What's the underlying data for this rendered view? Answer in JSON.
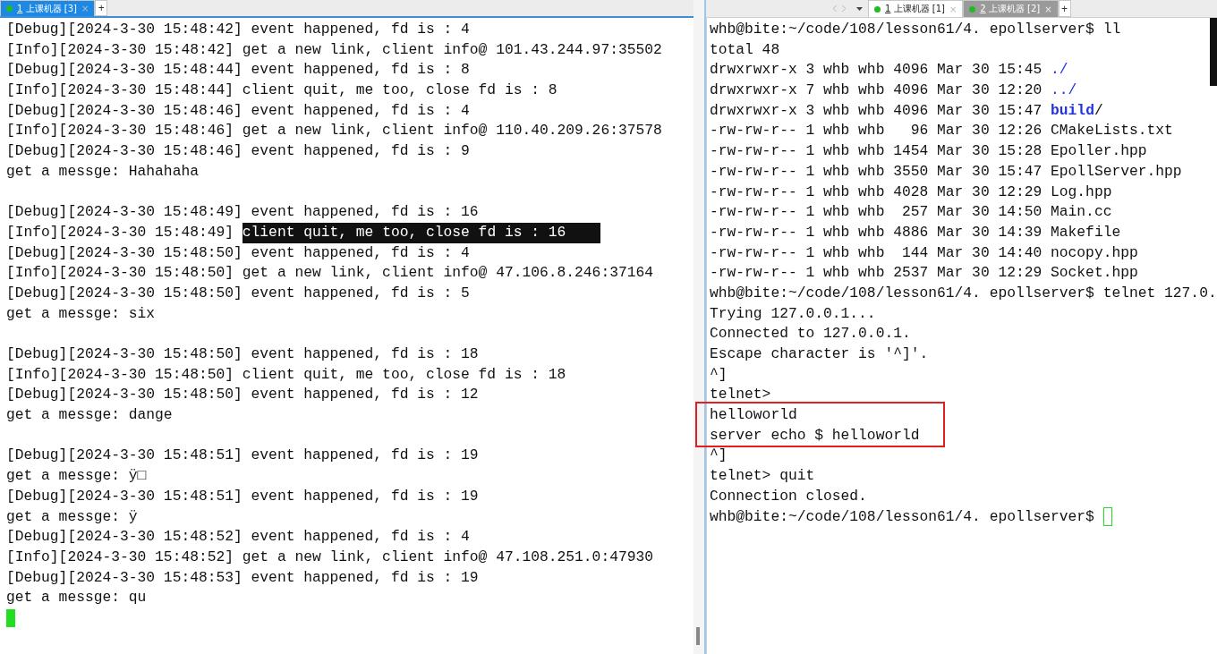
{
  "left_pane": {
    "tabs": [
      {
        "number": "1",
        "label": "上课机器 [3]",
        "selected": true,
        "focused": true,
        "close": "×"
      }
    ],
    "new_tab": "+",
    "blocks": [
      {
        "lines": [
          [
            {
              "text": "[Debug][2024-3-30 15:48:42] event happened, fd is : 4",
              "kind": "plain"
            }
          ],
          [
            {
              "text": "[Info][2024-3-30 15:48:42] get a new link, client info@ 101.43.244.97:35502",
              "kind": "plain"
            }
          ],
          [
            {
              "text": "[Debug][2024-3-30 15:48:44] event happened, fd is : 8",
              "kind": "plain"
            }
          ],
          [
            {
              "text": "[Info][2024-3-30 15:48:44] client quit, me too, close fd is : 8",
              "kind": "plain"
            }
          ],
          [
            {
              "text": "[Debug][2024-3-30 15:48:46] event happened, fd is : 4",
              "kind": "plain"
            }
          ],
          [
            {
              "text": "[Info][2024-3-30 15:48:46] get a new link, client info@ 110.40.209.26:37578",
              "kind": "plain"
            }
          ],
          [
            {
              "text": "[Debug][2024-3-30 15:48:46] event happened, fd is : 9",
              "kind": "plain"
            }
          ],
          [
            {
              "text": "get a messge: Hahahaha",
              "kind": "plain"
            }
          ]
        ]
      },
      {
        "lines": [
          [
            {
              "text": "[Debug][2024-3-30 15:48:49] event happened, fd is : 16",
              "kind": "plain"
            }
          ],
          [
            {
              "text": "[Info][2024-3-30 15:48:49] ",
              "kind": "plain"
            },
            {
              "text": "client quit, me too, close fd is : 16    ",
              "kind": "selected"
            }
          ],
          [
            {
              "text": "[Debug][2024-3-30 15:48:50] event happened, fd is : 4",
              "kind": "plain"
            }
          ],
          [
            {
              "text": "[Info][2024-3-30 15:48:50] get a new link, client info@ 47.106.8.246:37164",
              "kind": "plain"
            }
          ],
          [
            {
              "text": "[Debug][2024-3-30 15:48:50] event happened, fd is : 5",
              "kind": "plain"
            }
          ],
          [
            {
              "text": "get a messge: six",
              "kind": "plain"
            }
          ]
        ]
      },
      {
        "lines": [
          [
            {
              "text": "[Debug][2024-3-30 15:48:50] event happened, fd is : 18",
              "kind": "plain"
            }
          ],
          [
            {
              "text": "[Info][2024-3-30 15:48:50] client quit, me too, close fd is : 18",
              "kind": "plain"
            }
          ],
          [
            {
              "text": "[Debug][2024-3-30 15:48:50] event happened, fd is : 12",
              "kind": "plain"
            }
          ],
          [
            {
              "text": "get a messge: dange",
              "kind": "plain"
            }
          ]
        ]
      },
      {
        "lines": [
          [
            {
              "text": "[Debug][2024-3-30 15:48:51] event happened, fd is : 19",
              "kind": "plain"
            }
          ],
          [
            {
              "text": "get a messge: ÿ□",
              "kind": "plain"
            }
          ],
          [
            {
              "text": "[Debug][2024-3-30 15:48:51] event happened, fd is : 19",
              "kind": "plain"
            }
          ],
          [
            {
              "text": "get a messge: ÿ",
              "kind": "plain"
            }
          ],
          [
            {
              "text": "[Debug][2024-3-30 15:48:52] event happened, fd is : 4",
              "kind": "plain"
            }
          ],
          [
            {
              "text": "[Info][2024-3-30 15:48:52] get a new link, client info@ 47.108.251.0:47930",
              "kind": "plain"
            }
          ],
          [
            {
              "text": "[Debug][2024-3-30 15:48:53] event happened, fd is : 19",
              "kind": "plain"
            }
          ],
          [
            {
              "text": "get a messge: qu",
              "kind": "plain"
            }
          ]
        ]
      }
    ],
    "cursor": {
      "kind": "block"
    }
  },
  "right_pane": {
    "tabs": [
      {
        "number": "1",
        "label": "上课机器 [1]",
        "selected": true,
        "focused": false,
        "close": "×"
      },
      {
        "number": "2",
        "label": "上课机器 [2]",
        "selected": false,
        "close": "×"
      }
    ],
    "new_tab": "+",
    "blocks": [
      {
        "lines": [
          [
            {
              "text": "whb@bite:~/code/108/lesson61/4. epollserver$ ll",
              "kind": "plain"
            }
          ],
          [
            {
              "text": "total 48",
              "kind": "plain"
            }
          ],
          [
            {
              "text": "drwxrwxr-x 3 whb whb 4096 Mar 30 15:45 ",
              "kind": "plain"
            },
            {
              "text": "./",
              "kind": "dir"
            }
          ],
          [
            {
              "text": "drwxrwxr-x 7 whb whb 4096 Mar 30 12:20 ",
              "kind": "plain"
            },
            {
              "text": "../",
              "kind": "dir"
            }
          ],
          [
            {
              "text": "drwxrwxr-x 3 whb whb 4096 Mar 30 15:47 ",
              "kind": "plain"
            },
            {
              "text": "build",
              "kind": "bold_dir"
            },
            {
              "text": "/",
              "kind": "plain"
            }
          ],
          [
            {
              "text": "-rw-rw-r-- 1 whb whb   96 Mar 30 12:26 CMakeLists.txt",
              "kind": "plain"
            }
          ],
          [
            {
              "text": "-rw-rw-r-- 1 whb whb 1454 Mar 30 15:28 Epoller.hpp",
              "kind": "plain"
            }
          ],
          [
            {
              "text": "-rw-rw-r-- 1 whb whb 3550 Mar 30 15:47 EpollServer.hpp",
              "kind": "plain"
            }
          ],
          [
            {
              "text": "-rw-rw-r-- 1 whb whb 4028 Mar 30 12:29 Log.hpp",
              "kind": "plain"
            }
          ],
          [
            {
              "text": "-rw-rw-r-- 1 whb whb  257 Mar 30 14:50 Main.cc",
              "kind": "plain"
            }
          ],
          [
            {
              "text": "-rw-rw-r-- 1 whb whb 4886 Mar 30 14:39 Makefile",
              "kind": "plain"
            }
          ],
          [
            {
              "text": "-rw-rw-r-- 1 whb whb  144 Mar 30 14:40 nocopy.hpp",
              "kind": "plain"
            }
          ],
          [
            {
              "text": "-rw-rw-r-- 1 whb whb 2537 Mar 30 12:29 Socket.hpp",
              "kind": "plain"
            }
          ],
          [
            {
              "text": "whb@bite:~/code/108/lesson61/4. epollserver$ telnet 127.0.",
              "kind": "plain"
            }
          ],
          [
            {
              "text": "Trying 127.0.0.1...",
              "kind": "plain"
            }
          ],
          [
            {
              "text": "Connected to 127.0.0.1.",
              "kind": "plain"
            }
          ],
          [
            {
              "text": "Escape character is '^]'.",
              "kind": "plain"
            }
          ],
          [
            {
              "text": "^]",
              "kind": "plain"
            }
          ],
          [
            {
              "text": "telnet>",
              "kind": "plain"
            }
          ],
          [
            {
              "text": "helloworld",
              "kind": "plain"
            }
          ],
          [
            {
              "text": "server echo $ helloworld",
              "kind": "plain"
            }
          ],
          [
            {
              "text": "^]",
              "kind": "plain"
            }
          ],
          [
            {
              "text": "telnet> quit",
              "kind": "plain"
            }
          ],
          [
            {
              "text": "Connection closed.",
              "kind": "plain"
            }
          ],
          [
            {
              "text": "whb@bite:~/code/108/lesson61/4. epollserver$ ",
              "kind": "plain"
            }
          ]
        ]
      }
    ],
    "cursor": {
      "kind": "outline"
    }
  }
}
